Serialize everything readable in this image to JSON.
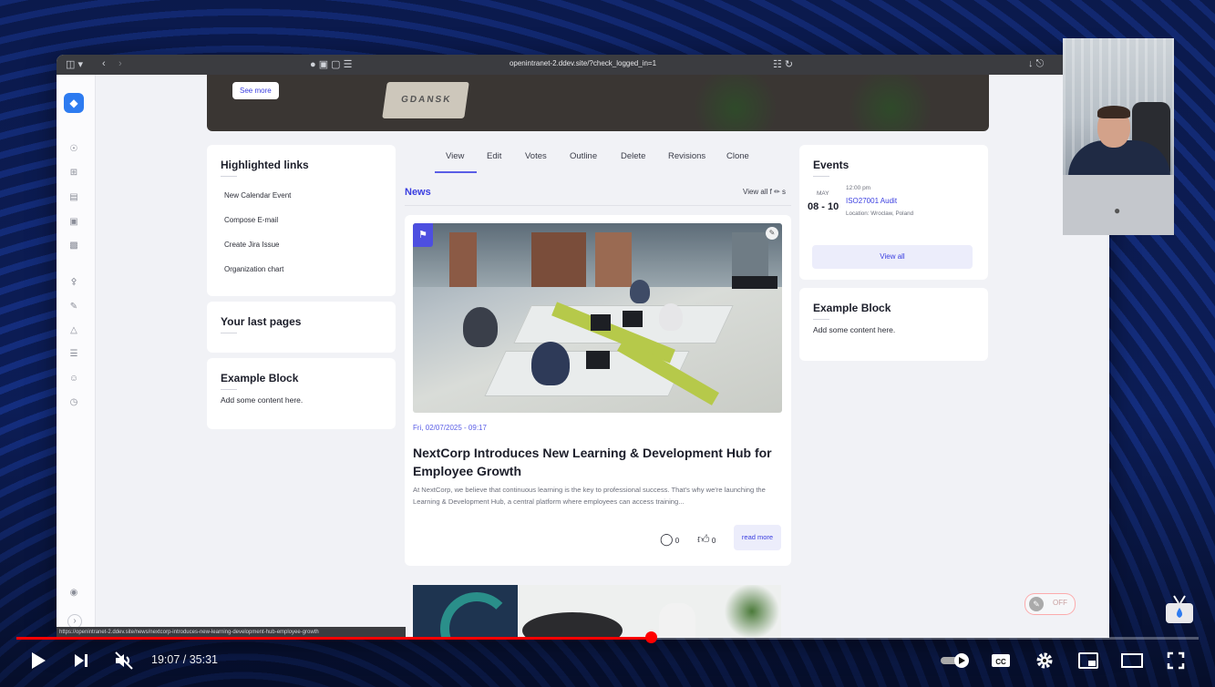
{
  "browser": {
    "url": "openintranet-2.ddev.site/?check_logged_in=1"
  },
  "hero": {
    "see_more": "See more",
    "sign_text": "GDANSK"
  },
  "highlighted_links": {
    "title": "Highlighted links",
    "items": [
      "New Calendar Event",
      "Compose E-mail",
      "Create Jira Issue",
      "Organization chart"
    ]
  },
  "last_pages": {
    "title": "Your last pages"
  },
  "example_block_left": {
    "title": "Example Block",
    "content": "Add some content here."
  },
  "tabs": [
    "View",
    "Edit",
    "Votes",
    "Outline",
    "Delete",
    "Revisions",
    "Clone"
  ],
  "news": {
    "title": "News",
    "view_all": "View all f",
    "view_all_tail": "s",
    "item": {
      "date": "Fri, 02/07/2025 - 09:17",
      "title": "NextCorp Introduces New Learning & Development Hub for Employee Growth",
      "excerpt": "At NextCorp, we believe that continuous learning is the key to professional success. That's why we're launching the Learning & Development Hub, a central platform where employees can access training...",
      "comments": "0",
      "likes": "0",
      "read_more": "read more"
    }
  },
  "events": {
    "title": "Events",
    "items": [
      {
        "month": "MAY",
        "day": "08 - 10",
        "time": "12:00 pm",
        "name": "ISO27001 Audit",
        "location": "Location: Wroclaw, Poland"
      }
    ],
    "view_all": "View all"
  },
  "example_block_right": {
    "title": "Example Block",
    "content": "Add some content here."
  },
  "status_bar_url": "https://openintranet-2.ddev.site/news/nextcorp-introduces-new-learning-development-hub-employee-growth",
  "player": {
    "current_time": "19:07",
    "duration": "35:31",
    "time_display": "19:07 / 35:31",
    "progress_fraction": 0.537,
    "autoplay_label": "OFF",
    "accent_color": "#ff0000"
  },
  "icons": {
    "play": "play-icon",
    "next": "next-icon",
    "mute": "volume-muted-icon",
    "autoplay": "autoplay-toggle-icon",
    "captions": "captions-icon",
    "settings": "gear-icon",
    "miniplayer": "miniplayer-icon",
    "theater": "theater-mode-icon",
    "fullscreen": "fullscreen-icon"
  }
}
